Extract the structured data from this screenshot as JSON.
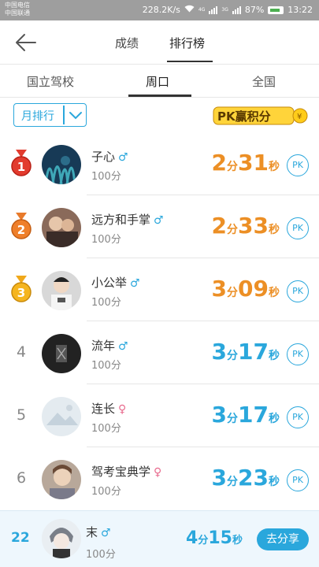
{
  "status_bar": {
    "carrier_1": "中国电信",
    "carrier_2": "中国联通",
    "speed": "228.2K/s",
    "signal_1": "4G",
    "signal_2": "3G",
    "battery": "87%",
    "time": "13:22"
  },
  "header": {
    "tabs": [
      "成绩",
      "排行榜"
    ],
    "active_tab": "排行榜"
  },
  "scope_tabs": {
    "items": [
      "国立驾校",
      "周口",
      "全国"
    ],
    "active": "周口"
  },
  "filter": {
    "label": "月排行"
  },
  "pk_banner": {
    "text": "PK赢积分",
    "coin_symbol": "¥"
  },
  "colors": {
    "accent": "#2aa7dc",
    "orange": "#ec8f25",
    "female": "#e86b8e"
  },
  "rankings": [
    {
      "rank": "1",
      "medal": "gold-red",
      "name": "子心",
      "gender_symbol": "♂",
      "gender": "male",
      "score": "100分",
      "min": "2",
      "min_unit": "分",
      "sec": "31",
      "sec_unit": "秒",
      "color": "orange",
      "pk": "PK"
    },
    {
      "rank": "2",
      "medal": "orange",
      "name": "远方和手掌",
      "gender_symbol": "♂",
      "gender": "male",
      "score": "100分",
      "min": "2",
      "min_unit": "分",
      "sec": "33",
      "sec_unit": "秒",
      "color": "orange",
      "pk": "PK"
    },
    {
      "rank": "3",
      "medal": "yellow",
      "name": "小公举",
      "gender_symbol": "♂",
      "gender": "male",
      "score": "100分",
      "min": "3",
      "min_unit": "分",
      "sec": "09",
      "sec_unit": "秒",
      "color": "orange",
      "pk": "PK"
    },
    {
      "rank": "4",
      "name": "流年",
      "gender_symbol": "♂",
      "gender": "male",
      "score": "100分",
      "min": "3",
      "min_unit": "分",
      "sec": "17",
      "sec_unit": "秒",
      "color": "blue",
      "pk": "PK"
    },
    {
      "rank": "5",
      "name": "连长",
      "gender_symbol": "♀",
      "gender": "female",
      "score": "100分",
      "min": "3",
      "min_unit": "分",
      "sec": "17",
      "sec_unit": "秒",
      "color": "blue",
      "pk": "PK"
    },
    {
      "rank": "6",
      "name": "驾考宝典学",
      "gender_symbol": "♀",
      "gender": "female",
      "score": "100分",
      "min": "3",
      "min_unit": "分",
      "sec": "23",
      "sec_unit": "秒",
      "color": "blue",
      "pk": "PK"
    }
  ],
  "me": {
    "rank": "22",
    "name": "末",
    "gender_symbol": "♂",
    "score": "100分",
    "min": "4",
    "min_unit": "分",
    "sec": "15",
    "sec_unit": "秒",
    "share_label": "去分享"
  }
}
